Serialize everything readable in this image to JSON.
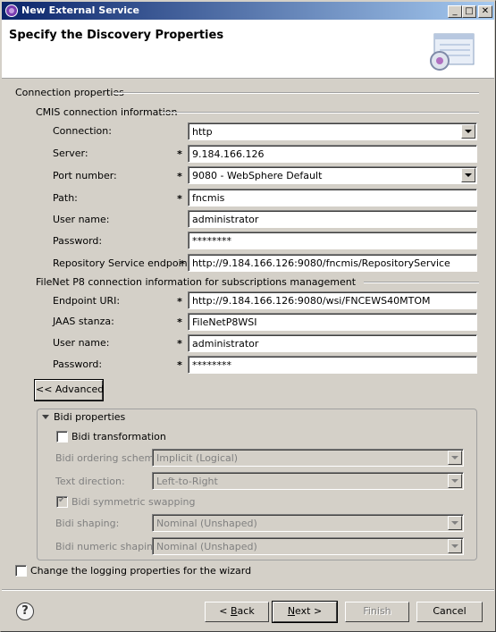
{
  "window": {
    "title": "New External Service",
    "minimize_glyph": "_",
    "maximize_glyph": "□",
    "close_glyph": "✕"
  },
  "banner": {
    "title": "Specify the Discovery Properties",
    "icon": "wizard-banner-icon"
  },
  "connection": {
    "group_label": "Connection properties",
    "cmis": {
      "group_label": "CMIS connection information",
      "fields": [
        {
          "label": "Connection:",
          "value": "http",
          "required": false,
          "type": "combo"
        },
        {
          "label": "Server:",
          "value": "9.184.166.126",
          "required": true,
          "type": "text"
        },
        {
          "label": "Port number:",
          "value": "9080 - WebSphere Default",
          "required": true,
          "type": "combo"
        },
        {
          "label": "Path:",
          "value": "fncmis",
          "required": true,
          "type": "text"
        },
        {
          "label": "User name:",
          "value": "administrator",
          "required": false,
          "type": "text"
        },
        {
          "label": "Password:",
          "value": "********",
          "required": false,
          "type": "text"
        },
        {
          "label": "Repository Service endpoint:",
          "value": "http://9.184.166.126:9080/fncmis/RepositoryService",
          "required": true,
          "type": "text"
        }
      ]
    },
    "filenet": {
      "group_label": "FileNet P8 connection information for subscriptions management",
      "fields": [
        {
          "label": "Endpoint URI:",
          "value": "http://9.184.166.126:9080/wsi/FNCEWS40MTOM",
          "required": true,
          "type": "text"
        },
        {
          "label": "JAAS stanza:",
          "value": "FileNetP8WSI",
          "required": true,
          "type": "text"
        },
        {
          "label": "User name:",
          "value": "administrator",
          "required": true,
          "type": "text"
        },
        {
          "label": "Password:",
          "value": "********",
          "required": true,
          "type": "text"
        }
      ]
    },
    "required_marker": "*",
    "advanced_button": "<< Advanced"
  },
  "bidi": {
    "section_label": "Bidi properties",
    "transformation_label": "Bidi transformation",
    "transformation_checked": false,
    "ordering_schema_label": "Bidi ordering schema:",
    "ordering_schema_value": "Implicit (Logical)",
    "text_direction_label": "Text direction:",
    "text_direction_value": "Left-to-Right",
    "symmetric_swapping_label": "Bidi symmetric swapping",
    "symmetric_swapping_checked": true,
    "shaping_label": "Bidi shaping:",
    "shaping_value": "Nominal (Unshaped)",
    "numeric_shaping_label": "Bidi numeric shaping:",
    "numeric_shaping_value": "Nominal (Unshaped)"
  },
  "logging": {
    "label": "Change the logging properties for the wizard",
    "checked": false
  },
  "footer": {
    "help_glyph": "?",
    "back_prefix": "< ",
    "back_mnemonic": "B",
    "back_rest": "ack",
    "next_mnemonic": "N",
    "next_rest": "ext >",
    "finish": "Finish",
    "cancel": "Cancel"
  },
  "colors": {
    "title_gradient_start": "#0a246a",
    "title_gradient_end": "#a6caf0",
    "dialog_bg": "#d4d0c8",
    "disabled_text": "#808080"
  }
}
